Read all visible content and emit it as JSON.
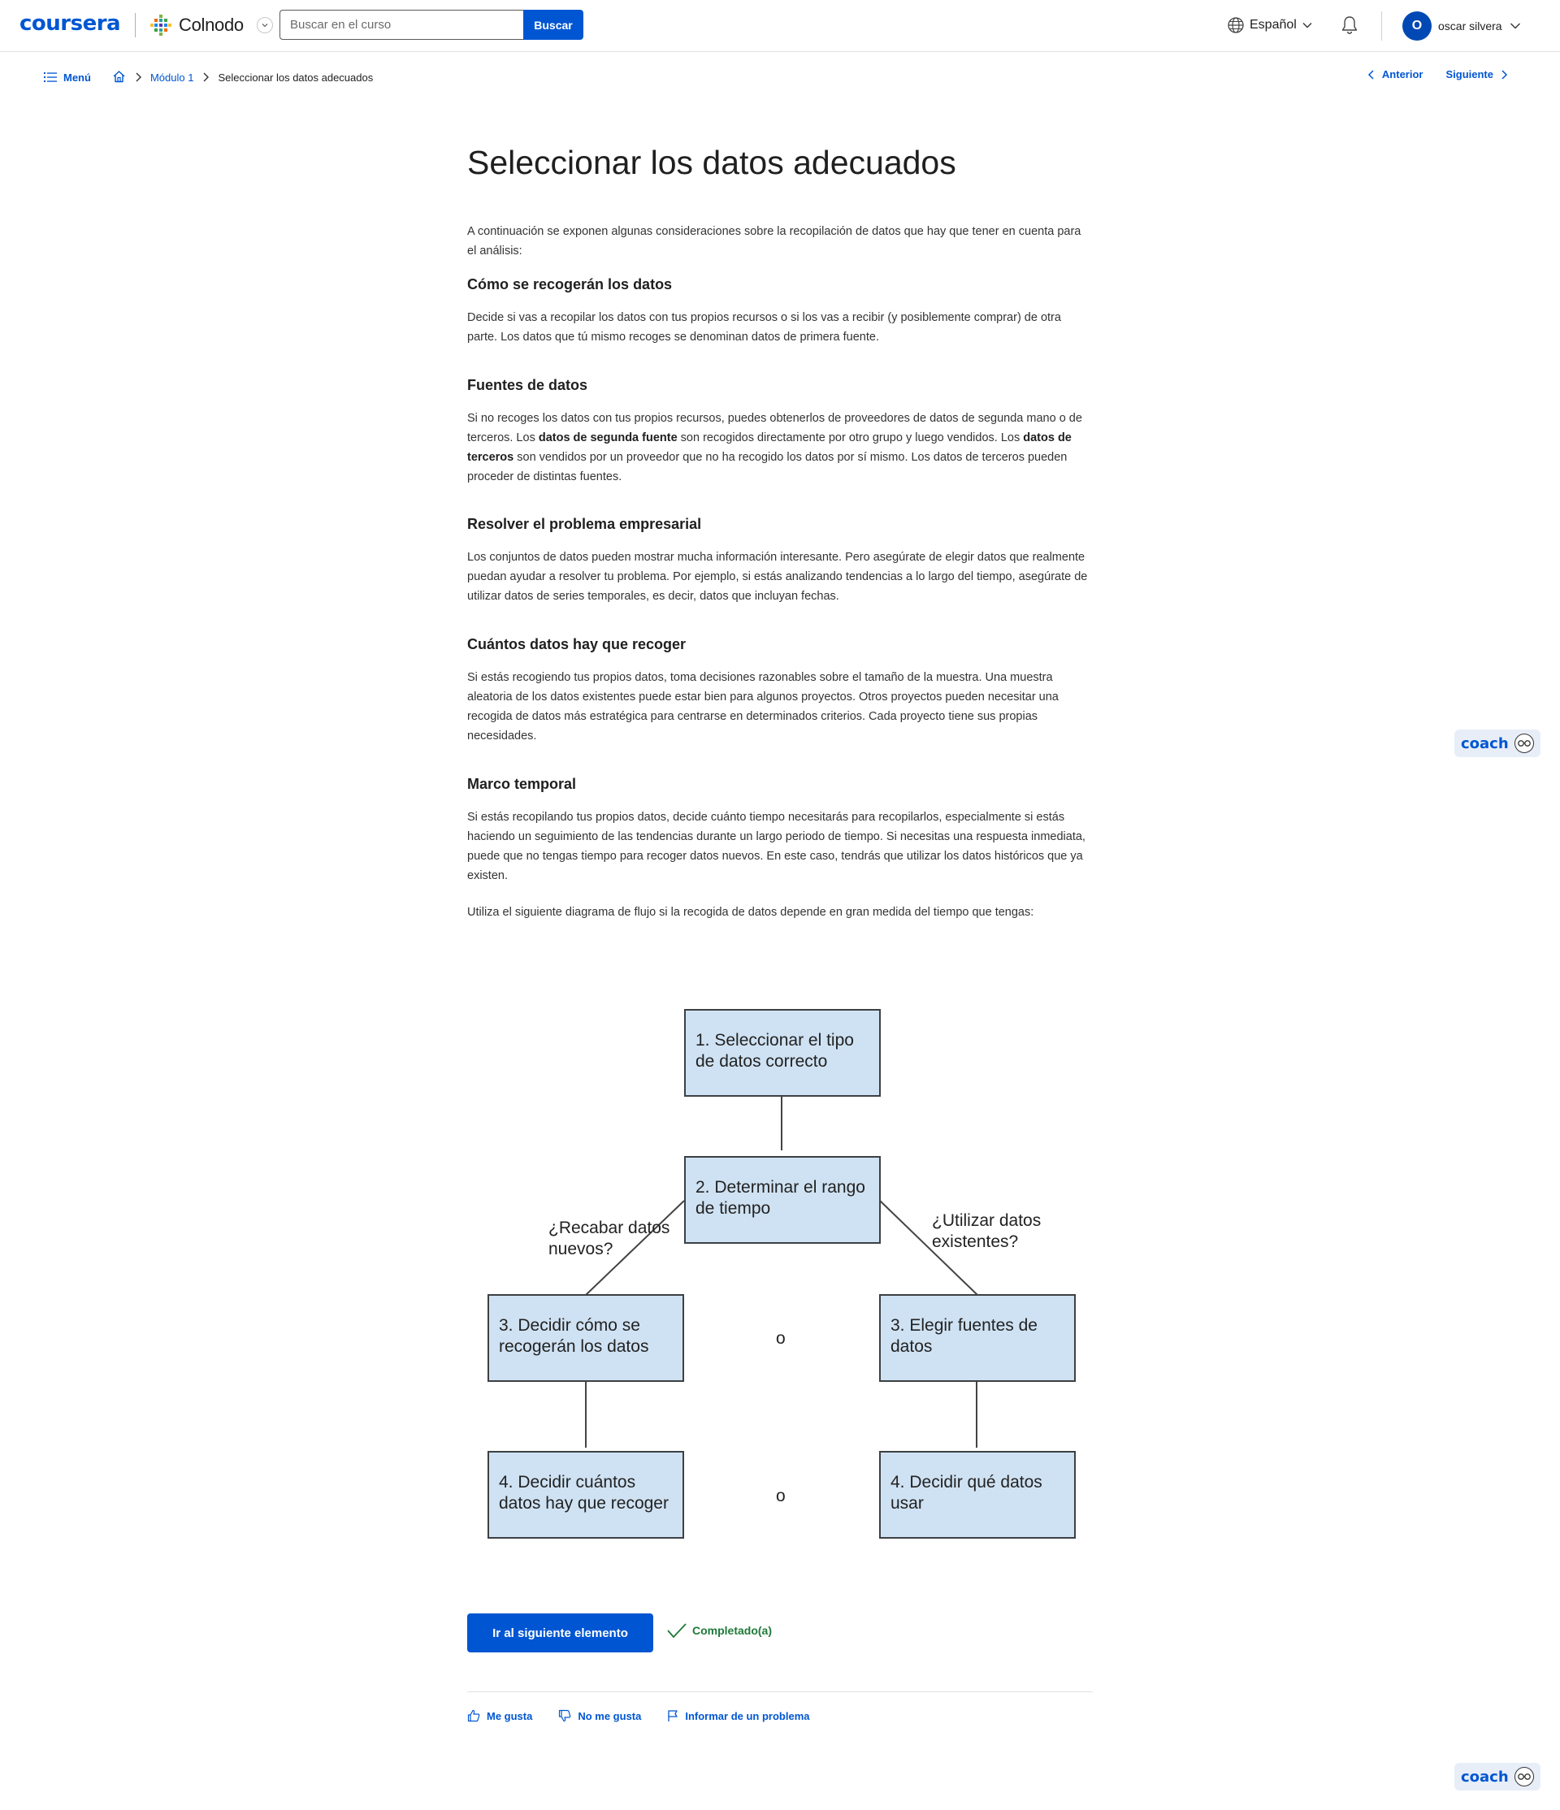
{
  "header": {
    "logo": "coursera",
    "partner": "Colnodo",
    "search": {
      "placeholder": "Buscar en el curso",
      "button": "Buscar"
    },
    "language": "Español",
    "user": {
      "initial": "O",
      "name": "oscar silvera"
    }
  },
  "breadcrumb": {
    "menu": "Menú",
    "module": "Módulo 1",
    "current": "Seleccionar los datos adecuados"
  },
  "pager": {
    "prev": "Anterior",
    "next": "Siguiente"
  },
  "content": {
    "title": "Seleccionar los datos adecuados",
    "intro": "A continuación se exponen algunas consideraciones sobre la recopilación de datos que hay que tener en cuenta para el análisis:",
    "sections": [
      {
        "heading": "Cómo se recogerán los datos",
        "body": "Decide si vas a recopilar los datos con tus propios recursos o si los vas a recibir (y posiblemente comprar) de otra parte. Los datos que tú mismo recoges se denominan datos de primera fuente."
      },
      {
        "heading": "Fuentes de datos",
        "body_a": "Si no recoges los datos con tus propios recursos, puedes obtenerlos de proveedores de datos de segunda mano o de terceros. Los ",
        "bold_a": "datos de segunda fuente",
        "body_b": " son recogidos directamente por otro grupo y luego vendidos. Los ",
        "bold_b": "datos de terceros",
        "body_c": " son vendidos por un proveedor que no ha recogido los datos por sí mismo. Los datos de terceros pueden proceder de distintas fuentes."
      },
      {
        "heading": "Resolver el problema empresarial",
        "body": "Los conjuntos de datos pueden mostrar mucha información interesante. Pero asegúrate de elegir datos que realmente puedan ayudar a resolver tu problema. Por ejemplo, si estás analizando tendencias a lo largo del tiempo, asegúrate de utilizar datos de series temporales, es decir, datos que incluyan fechas."
      },
      {
        "heading": "Cuántos datos hay que recoger",
        "body": "Si estás recogiendo tus propios datos, toma decisiones razonables sobre el tamaño de la muestra. Una muestra aleatoria de los datos existentes puede estar bien para algunos proyectos. Otros proyectos pueden necesitar una recogida de datos más estratégica para centrarse en determinados criterios. Cada proyecto tiene sus propias necesidades."
      },
      {
        "heading": "Marco temporal",
        "body": "Si estás recopilando tus propios datos, decide cuánto tiempo necesitarás para recopilarlos, especialmente si estás haciendo un seguimiento de las tendencias durante un largo periodo de tiempo. Si necesitas una respuesta inmediata, puede que no tengas tiempo para recoger datos nuevos. En este caso, tendrás que utilizar los datos históricos que ya existen."
      }
    ],
    "flow_intro": "Utiliza el siguiente diagrama de flujo si la recogida de datos depende en gran medida del tiempo que tengas:"
  },
  "flowchart": {
    "step1": "1. Seleccionar el tipo de datos correcto",
    "step2": "2. Determinar el rango de tiempo",
    "left_question": "¿Recabar datos nuevos?",
    "right_question": "¿Utilizar datos existentes?",
    "step3_left": "3. Decidir cómo se recogerán los datos",
    "step3_right": "3. Elegir fuentes de datos",
    "step4_left": "4. Decidir cuántos datos hay que recoger",
    "step4_right": "4. Decidir qué datos usar",
    "or": "o"
  },
  "actions": {
    "next_item": "Ir al siguiente elemento",
    "completed": "Completado(a)",
    "like": "Me gusta",
    "dislike": "No me gusta",
    "report": "Informar de un problema"
  },
  "coach": {
    "label": "coach"
  },
  "colors": {
    "brand": "#0056d2",
    "box_fill": "#cfe2f3",
    "success": "#1f7a3a"
  }
}
